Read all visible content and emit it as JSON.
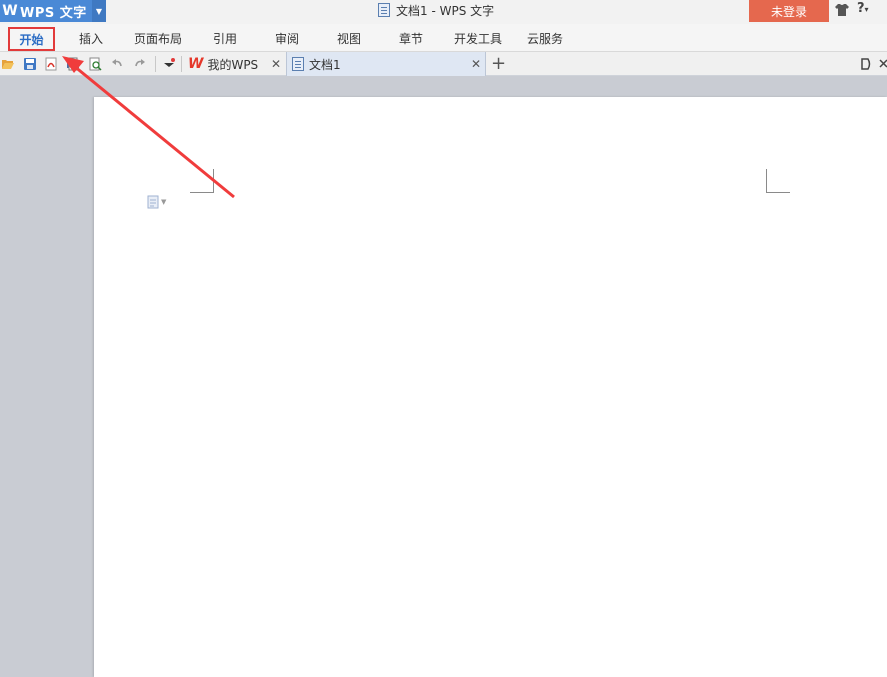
{
  "app": {
    "name": "WPS 文字",
    "logo": "W"
  },
  "window": {
    "title": "文档1 - WPS 文字"
  },
  "login": {
    "label": "未登录"
  },
  "help": {
    "label": "?"
  },
  "ribbon": {
    "tabs": [
      {
        "label": "开始"
      },
      {
        "label": "插入"
      },
      {
        "label": "页面布局"
      },
      {
        "label": "引用"
      },
      {
        "label": "审阅"
      },
      {
        "label": "视图"
      },
      {
        "label": "章节"
      },
      {
        "label": "开发工具"
      },
      {
        "label": "云服务"
      }
    ]
  },
  "doc_tabs": [
    {
      "label": "我的WPS"
    },
    {
      "label": "文档1"
    }
  ],
  "colors": {
    "accent": "#4a89d6",
    "login": "#e5684e",
    "highlight": "#e23a3a"
  }
}
